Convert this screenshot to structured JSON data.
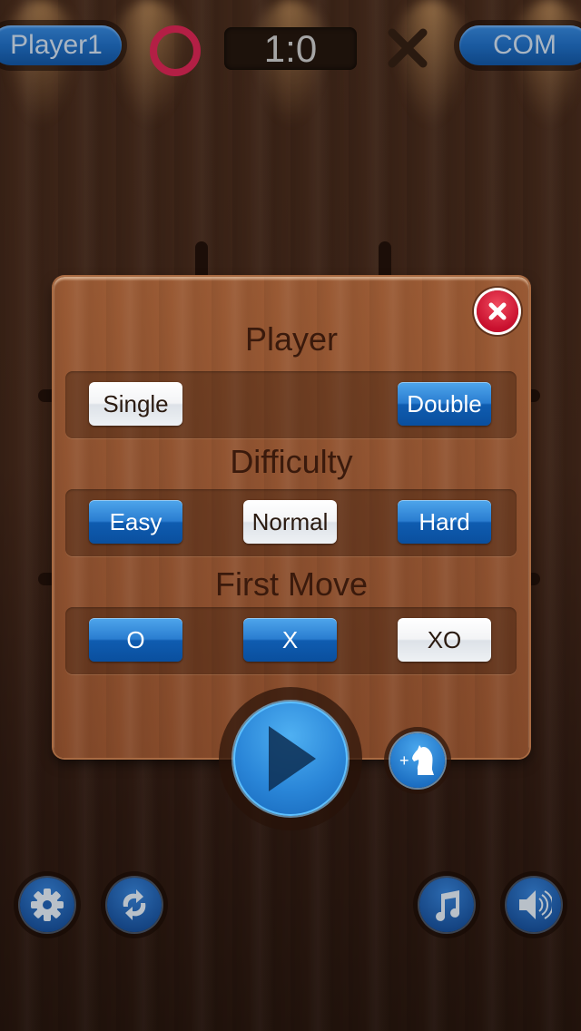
{
  "header": {
    "player1_label": "Player1",
    "player2_label": "COM",
    "score": "1:0",
    "player1_mark": "O",
    "player2_mark": "X"
  },
  "modal": {
    "sections": [
      {
        "title": "Player",
        "options": [
          {
            "label": "Single",
            "selected": true
          },
          {
            "label": "Double",
            "selected": false
          }
        ]
      },
      {
        "title": "Difficulty",
        "options": [
          {
            "label": "Easy",
            "selected": false
          },
          {
            "label": "Normal",
            "selected": true
          },
          {
            "label": "Hard",
            "selected": false
          }
        ]
      },
      {
        "title": "First Move",
        "options": [
          {
            "label": "O",
            "selected": false
          },
          {
            "label": "X",
            "selected": false
          },
          {
            "label": "XO",
            "selected": true
          }
        ]
      }
    ],
    "close_icon": "close-icon",
    "play_icon": "play-icon",
    "add_chess_icon": "knight-plus-icon",
    "add_chess_plus": "+"
  },
  "footer": {
    "buttons": [
      "settings",
      "restart",
      "music",
      "sound"
    ]
  },
  "colors": {
    "o_mark": "#b31f45",
    "x_mark": "#2a1a10",
    "selected_option": "#ffffff",
    "option": "#1a6cc0"
  }
}
